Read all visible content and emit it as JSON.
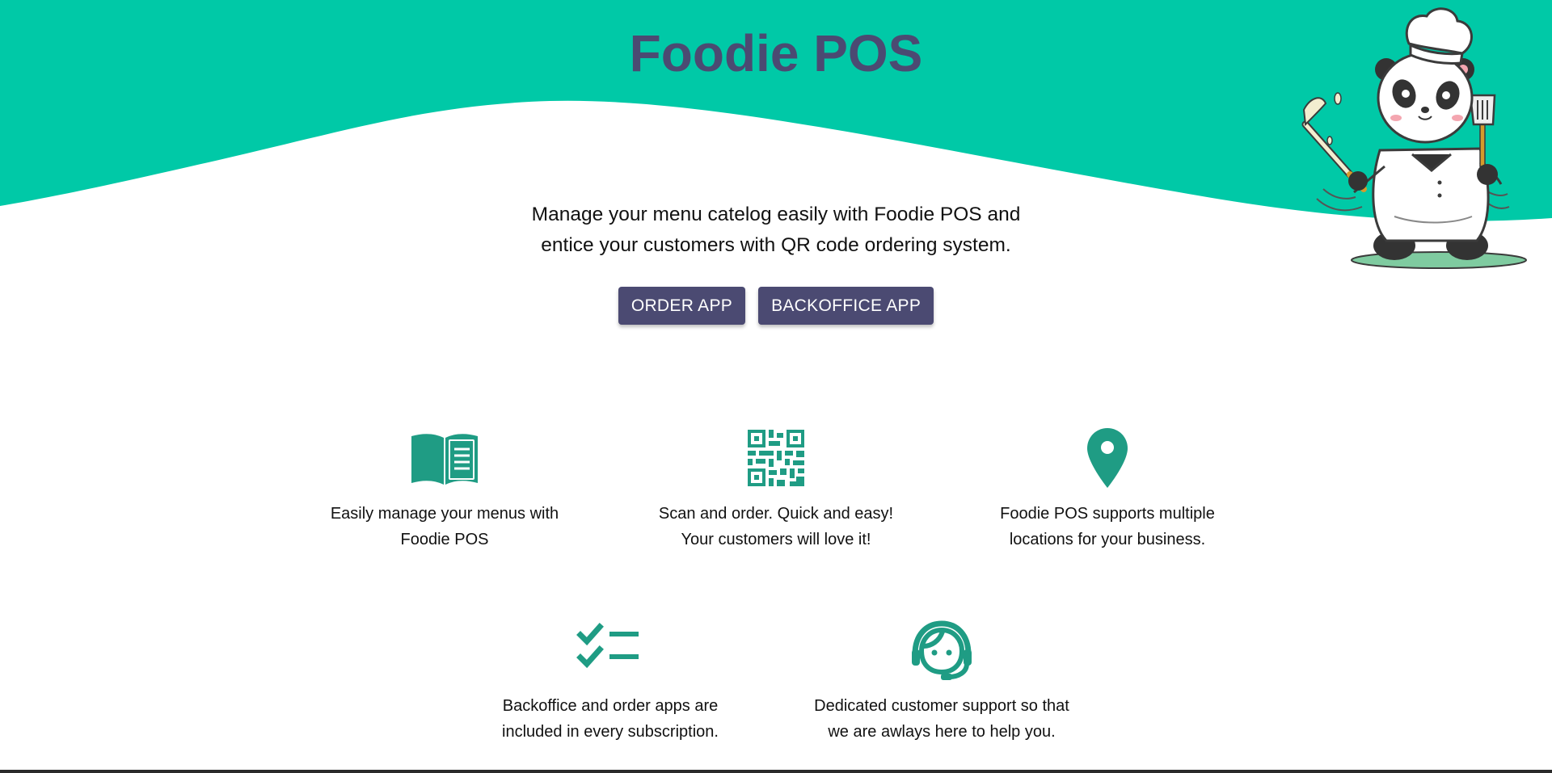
{
  "header": {
    "title": "Foodie POS",
    "accent_color": "#00c9a7",
    "title_color": "#4b4a72"
  },
  "hero": {
    "tagline_line1": "Manage your menu catelog easily with Foodie POS and",
    "tagline_line2": "entice your customers with QR code ordering system.",
    "mascot_icon": "panda-chef-illustration"
  },
  "buttons": {
    "order_app": "ORDER APP",
    "backoffice_app": "BACKOFFICE APP",
    "color": "#4b4a72"
  },
  "features": [
    {
      "icon": "open-book-menu-icon",
      "line1": "Easily manage your menus with",
      "line2": "Foodie POS"
    },
    {
      "icon": "qr-code-icon",
      "line1": "Scan and order. Quick and easy!",
      "line2": "Your customers will love it!"
    },
    {
      "icon": "location-pin-icon",
      "line1": "Foodie POS supports multiple",
      "line2": "locations for your business."
    },
    {
      "icon": "checklist-icon",
      "line1": "Backoffice and order apps are",
      "line2": "included in every subscription."
    },
    {
      "icon": "customer-support-headset-icon",
      "line1": "Dedicated customer support so that",
      "line2": "we are awlays here to help you."
    }
  ],
  "icon_color": "#1f9c84"
}
